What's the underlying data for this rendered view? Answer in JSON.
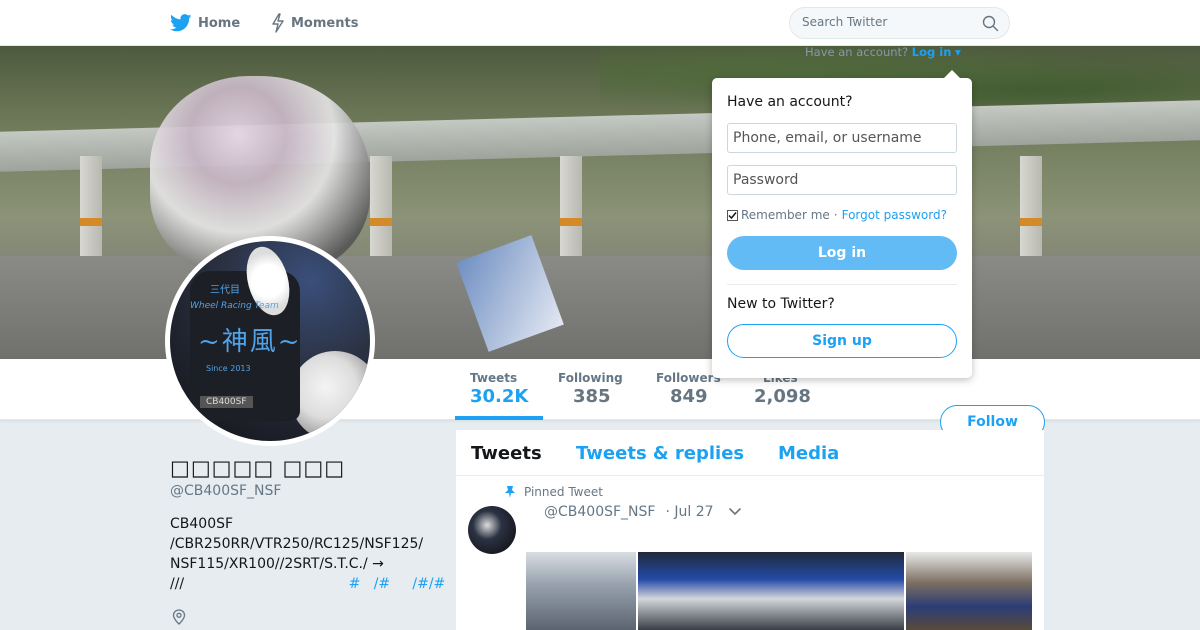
{
  "nav": {
    "home_label": "Home",
    "moments_label": "Moments",
    "search_placeholder": "Search Twitter"
  },
  "login_hint": {
    "prefix": "Have an account?",
    "link": "Log in"
  },
  "stats": [
    {
      "label": "Tweets",
      "value": "30.2K"
    },
    {
      "label": "Following",
      "value": "385"
    },
    {
      "label": "Followers",
      "value": "849"
    },
    {
      "label": "Likes",
      "value": "2,098"
    }
  ],
  "follow_label": "Follow",
  "avatar": {
    "line1": "三代目",
    "line2": "Wheel Racing Team",
    "kanji": "~神風~",
    "since": "Since 2013",
    "tag": "CB400SF"
  },
  "profile": {
    "name": "□□□□□ □□□",
    "handle": "@CB400SF_NSF",
    "bio_lines": [
      "CB400SF",
      "/CBR250RR/VTR250/RC125/NSF125/",
      "NSF115/XR100//2SRT/S.T.C./ →"
    ],
    "bio_last_prefix": "///",
    "bio_last_tags": "#   /#     /#/#"
  },
  "timeline": {
    "tabs": [
      "Tweets",
      "Tweets & replies",
      "Media"
    ],
    "pinned_label": "Pinned Tweet",
    "tweet_handle": "@CB400SF_NSF",
    "tweet_date": "· Jul 27"
  },
  "login_dropdown": {
    "title": "Have an account?",
    "username_placeholder": "Phone, email, or username",
    "password_placeholder": "Password",
    "remember_label": "Remember me",
    "separator": "·",
    "forgot_label": "Forgot password?",
    "login_label": "Log in",
    "new_label": "New to Twitter?",
    "signup_label": "Sign up"
  },
  "colors": {
    "accent": "#1da1f2",
    "login_button": "#63bbf5",
    "page_bg": "#e6ecf0"
  },
  "icons": [
    "twitter-bird-icon",
    "lightning-icon",
    "search-icon",
    "pin-icon",
    "chevron-down-icon",
    "location-pin-icon",
    "checkbox-icon"
  ]
}
